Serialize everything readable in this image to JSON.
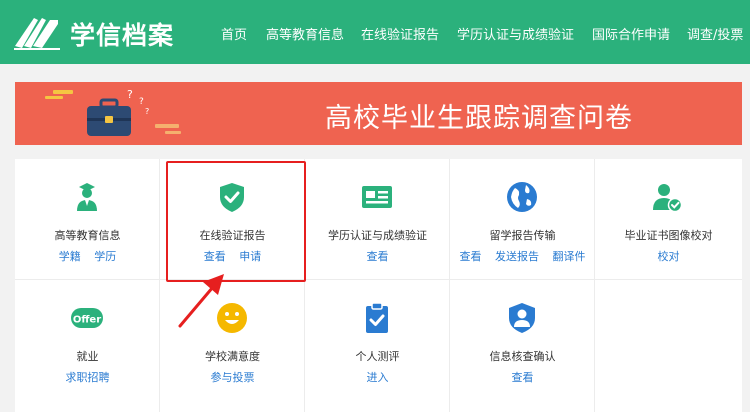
{
  "header": {
    "logo_text": "学信档案",
    "nav": [
      "首页",
      "高等教育信息",
      "在线验证报告",
      "学历认证与成绩验证",
      "国际合作申请",
      "调查/投票"
    ]
  },
  "banner": {
    "title": "高校毕业生跟踪调查问卷"
  },
  "colors": {
    "brand": "#2bb17c",
    "banner": "#ef6350",
    "link": "#2a7bd1",
    "highlight": "#e61f1f"
  },
  "grid": {
    "row1": [
      {
        "icon": "graduate-user-icon",
        "title": "高等教育信息",
        "links": [
          "学籍",
          "学历"
        ]
      },
      {
        "icon": "shield-check-icon",
        "title": "在线验证报告",
        "links": [
          "查看",
          "申请"
        ]
      },
      {
        "icon": "id-card-icon",
        "title": "学历认证与成绩验证",
        "links": [
          "查看"
        ]
      },
      {
        "icon": "globe-icon",
        "title": "留学报告传输",
        "links": [
          "查看",
          "发送报告",
          "翻译件"
        ]
      },
      {
        "icon": "user-check-icon",
        "title": "毕业证书图像校对",
        "links": [
          "校对"
        ]
      }
    ],
    "row2": [
      {
        "icon": "offer-icon",
        "title": "就业",
        "links": [
          "求职招聘"
        ],
        "icon_text": "Offer"
      },
      {
        "icon": "smiley-icon",
        "title": "学校满意度",
        "links": [
          "参与投票"
        ]
      },
      {
        "icon": "clipboard-check-icon",
        "title": "个人测评",
        "links": [
          "进入"
        ]
      },
      {
        "icon": "user-shield-icon",
        "title": "信息核查确认",
        "links": [
          "查看"
        ]
      }
    ]
  }
}
